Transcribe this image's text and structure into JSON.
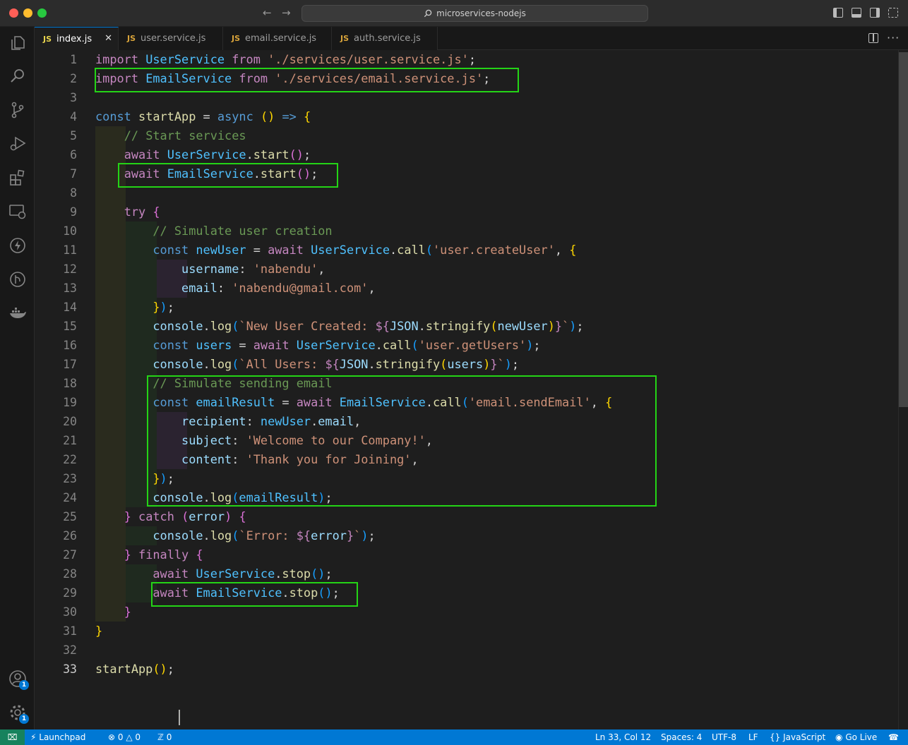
{
  "window": {
    "title": "microservices-nodejs"
  },
  "tabs": [
    {
      "label": "index.js",
      "icon": "JS",
      "active": true
    },
    {
      "label": "user.service.js",
      "icon": "JS",
      "active": false
    },
    {
      "label": "email.service.js",
      "icon": "JS",
      "active": false
    },
    {
      "label": "auth.service.js",
      "icon": "JS",
      "active": false
    }
  ],
  "activity_bar": {
    "items": [
      "explorer-icon",
      "search-icon",
      "source-control-icon",
      "run-debug-icon",
      "extensions-icon",
      "remote-explorer-icon",
      "thunder-client-icon",
      "git-graph-icon",
      "docker-icon"
    ],
    "accounts_badge": "1",
    "settings_badge": "1"
  },
  "editor": {
    "current_line": 33,
    "lines": [
      [
        [
          "kw",
          "import"
        ],
        [
          "p",
          " "
        ],
        [
          "cls",
          "UserService"
        ],
        [
          "p",
          " "
        ],
        [
          "kw",
          "from"
        ],
        [
          "p",
          " "
        ],
        [
          "str",
          "'./services/user.service.js'"
        ],
        [
          "p",
          ";"
        ]
      ],
      [
        [
          "kw",
          "import"
        ],
        [
          "p",
          " "
        ],
        [
          "cls",
          "EmailService"
        ],
        [
          "p",
          " "
        ],
        [
          "kw",
          "from"
        ],
        [
          "p",
          " "
        ],
        [
          "str",
          "'./services/email.service.js'"
        ],
        [
          "p",
          ";"
        ]
      ],
      [],
      [
        [
          "dec",
          "const"
        ],
        [
          "p",
          " "
        ],
        [
          "fn",
          "startApp"
        ],
        [
          "p",
          " = "
        ],
        [
          "dec",
          "async"
        ],
        [
          "p",
          " "
        ],
        [
          "b1",
          "()"
        ],
        [
          "p",
          " "
        ],
        [
          "dec",
          "=>"
        ],
        [
          "p",
          " "
        ],
        [
          "b1",
          "{"
        ]
      ],
      [
        [
          "p",
          "    "
        ],
        [
          "com",
          "// Start services"
        ]
      ],
      [
        [
          "p",
          "    "
        ],
        [
          "kw",
          "await"
        ],
        [
          "p",
          " "
        ],
        [
          "cls",
          "UserService"
        ],
        [
          "p",
          "."
        ],
        [
          "fn",
          "start"
        ],
        [
          "b2",
          "()"
        ],
        [
          "p",
          ";"
        ]
      ],
      [
        [
          "p",
          "    "
        ],
        [
          "kw",
          "await"
        ],
        [
          "p",
          " "
        ],
        [
          "cls",
          "EmailService"
        ],
        [
          "p",
          "."
        ],
        [
          "fn",
          "start"
        ],
        [
          "b2",
          "()"
        ],
        [
          "p",
          ";"
        ]
      ],
      [],
      [
        [
          "p",
          "    "
        ],
        [
          "kw",
          "try"
        ],
        [
          "p",
          " "
        ],
        [
          "b2",
          "{"
        ]
      ],
      [
        [
          "p",
          "        "
        ],
        [
          "com",
          "// Simulate user creation"
        ]
      ],
      [
        [
          "p",
          "        "
        ],
        [
          "dec",
          "const"
        ],
        [
          "p",
          " "
        ],
        [
          "cls",
          "newUser"
        ],
        [
          "p",
          " = "
        ],
        [
          "kw",
          "await"
        ],
        [
          "p",
          " "
        ],
        [
          "cls",
          "UserService"
        ],
        [
          "p",
          "."
        ],
        [
          "fn",
          "call"
        ],
        [
          "b3",
          "("
        ],
        [
          "str",
          "'user.createUser'"
        ],
        [
          "p",
          ", "
        ],
        [
          "b1",
          "{"
        ]
      ],
      [
        [
          "p",
          "            "
        ],
        [
          "prop",
          "username"
        ],
        [
          "p",
          ": "
        ],
        [
          "str",
          "'nabendu'"
        ],
        [
          "p",
          ","
        ]
      ],
      [
        [
          "p",
          "            "
        ],
        [
          "prop",
          "email"
        ],
        [
          "p",
          ": "
        ],
        [
          "str",
          "'nabendu@gmail.com'"
        ],
        [
          "p",
          ","
        ]
      ],
      [
        [
          "p",
          "        "
        ],
        [
          "b1",
          "}"
        ],
        [
          "b3",
          ")"
        ],
        [
          "p",
          ";"
        ]
      ],
      [
        [
          "p",
          "        "
        ],
        [
          "prop",
          "console"
        ],
        [
          "p",
          "."
        ],
        [
          "fn",
          "log"
        ],
        [
          "b3",
          "("
        ],
        [
          "str",
          "`New User Created: "
        ],
        [
          "kw",
          "${"
        ],
        [
          "prop",
          "JSON"
        ],
        [
          "p",
          "."
        ],
        [
          "fn",
          "stringify"
        ],
        [
          "b1",
          "("
        ],
        [
          "prop",
          "newUser"
        ],
        [
          "b1",
          ")"
        ],
        [
          "kw",
          "}"
        ],
        [
          "str",
          "`"
        ],
        [
          "b3",
          ")"
        ],
        [
          "p",
          ";"
        ]
      ],
      [
        [
          "p",
          "        "
        ],
        [
          "dec",
          "const"
        ],
        [
          "p",
          " "
        ],
        [
          "cls",
          "users"
        ],
        [
          "p",
          " = "
        ],
        [
          "kw",
          "await"
        ],
        [
          "p",
          " "
        ],
        [
          "cls",
          "UserService"
        ],
        [
          "p",
          "."
        ],
        [
          "fn",
          "call"
        ],
        [
          "b3",
          "("
        ],
        [
          "str",
          "'user.getUsers'"
        ],
        [
          "b3",
          ")"
        ],
        [
          "p",
          ";"
        ]
      ],
      [
        [
          "p",
          "        "
        ],
        [
          "prop",
          "console"
        ],
        [
          "p",
          "."
        ],
        [
          "fn",
          "log"
        ],
        [
          "b3",
          "("
        ],
        [
          "str",
          "`All Users: "
        ],
        [
          "kw",
          "${"
        ],
        [
          "prop",
          "JSON"
        ],
        [
          "p",
          "."
        ],
        [
          "fn",
          "stringify"
        ],
        [
          "b1",
          "("
        ],
        [
          "prop",
          "users"
        ],
        [
          "b1",
          ")"
        ],
        [
          "kw",
          "}"
        ],
        [
          "str",
          "`"
        ],
        [
          "b3",
          ")"
        ],
        [
          "p",
          ";"
        ]
      ],
      [
        [
          "p",
          "        "
        ],
        [
          "com",
          "// Simulate sending email"
        ]
      ],
      [
        [
          "p",
          "        "
        ],
        [
          "dec",
          "const"
        ],
        [
          "p",
          " "
        ],
        [
          "cls",
          "emailResult"
        ],
        [
          "p",
          " = "
        ],
        [
          "kw",
          "await"
        ],
        [
          "p",
          " "
        ],
        [
          "cls",
          "EmailService"
        ],
        [
          "p",
          "."
        ],
        [
          "fn",
          "call"
        ],
        [
          "b3",
          "("
        ],
        [
          "str",
          "'email.sendEmail'"
        ],
        [
          "p",
          ", "
        ],
        [
          "b1",
          "{"
        ]
      ],
      [
        [
          "p",
          "            "
        ],
        [
          "prop",
          "recipient"
        ],
        [
          "p",
          ": "
        ],
        [
          "cls",
          "newUser"
        ],
        [
          "p",
          "."
        ],
        [
          "prop",
          "email"
        ],
        [
          "p",
          ","
        ]
      ],
      [
        [
          "p",
          "            "
        ],
        [
          "prop",
          "subject"
        ],
        [
          "p",
          ": "
        ],
        [
          "str",
          "'Welcome to our Company!'"
        ],
        [
          "p",
          ","
        ]
      ],
      [
        [
          "p",
          "            "
        ],
        [
          "prop",
          "content"
        ],
        [
          "p",
          ": "
        ],
        [
          "str",
          "'Thank you for Joining'"
        ],
        [
          "p",
          ","
        ]
      ],
      [
        [
          "p",
          "        "
        ],
        [
          "b1",
          "}"
        ],
        [
          "b3",
          ")"
        ],
        [
          "p",
          ";"
        ]
      ],
      [
        [
          "p",
          "        "
        ],
        [
          "prop",
          "console"
        ],
        [
          "p",
          "."
        ],
        [
          "fn",
          "log"
        ],
        [
          "b3",
          "("
        ],
        [
          "cls",
          "emailResult"
        ],
        [
          "b3",
          ")"
        ],
        [
          "p",
          ";"
        ]
      ],
      [
        [
          "p",
          "    "
        ],
        [
          "b2",
          "}"
        ],
        [
          "p",
          " "
        ],
        [
          "kw",
          "catch"
        ],
        [
          "p",
          " "
        ],
        [
          "b2",
          "("
        ],
        [
          "prop",
          "error"
        ],
        [
          "b2",
          ")"
        ],
        [
          "p",
          " "
        ],
        [
          "b2",
          "{"
        ]
      ],
      [
        [
          "p",
          "        "
        ],
        [
          "prop",
          "console"
        ],
        [
          "p",
          "."
        ],
        [
          "fn",
          "log"
        ],
        [
          "b3",
          "("
        ],
        [
          "str",
          "`Error: "
        ],
        [
          "kw",
          "${"
        ],
        [
          "prop",
          "error"
        ],
        [
          "kw",
          "}"
        ],
        [
          "str",
          "`"
        ],
        [
          "b3",
          ")"
        ],
        [
          "p",
          ";"
        ]
      ],
      [
        [
          "p",
          "    "
        ],
        [
          "b2",
          "}"
        ],
        [
          "p",
          " "
        ],
        [
          "kw",
          "finally"
        ],
        [
          "p",
          " "
        ],
        [
          "b2",
          "{"
        ]
      ],
      [
        [
          "p",
          "        "
        ],
        [
          "kw",
          "await"
        ],
        [
          "p",
          " "
        ],
        [
          "cls",
          "UserService"
        ],
        [
          "p",
          "."
        ],
        [
          "fn",
          "stop"
        ],
        [
          "b3",
          "()"
        ],
        [
          "p",
          ";"
        ]
      ],
      [
        [
          "p",
          "        "
        ],
        [
          "kw",
          "await"
        ],
        [
          "p",
          " "
        ],
        [
          "cls",
          "EmailService"
        ],
        [
          "p",
          "."
        ],
        [
          "fn",
          "stop"
        ],
        [
          "b3",
          "()"
        ],
        [
          "p",
          ";"
        ]
      ],
      [
        [
          "p",
          "    "
        ],
        [
          "b2",
          "}"
        ]
      ],
      [
        [
          "b1",
          "}"
        ]
      ],
      [],
      [
        [
          "fn",
          "startApp"
        ],
        [
          "b1",
          "()"
        ],
        [
          "p",
          ";"
        ]
      ]
    ]
  },
  "status_bar": {
    "launchpad": "Launchpad",
    "errors": "0",
    "warnings": "0",
    "ports": "0",
    "cursor_position": "Ln 33, Col 12",
    "indentation": "Spaces: 4",
    "encoding": "UTF-8",
    "eol": "LF",
    "language": "JavaScript",
    "go_live": "Go Live"
  },
  "colors": {
    "accent": "#0078d4",
    "highlight_box": "#24d416",
    "keyword": "#c586c0",
    "declaration": "#569cd6",
    "variable": "#4fc1ff",
    "function": "#dcdcaa",
    "string": "#ce9178",
    "comment": "#6a9955",
    "property": "#9cdcfe",
    "bracket_1": "#ffd700",
    "bracket_2": "#da70d6",
    "bracket_3": "#179fff"
  }
}
